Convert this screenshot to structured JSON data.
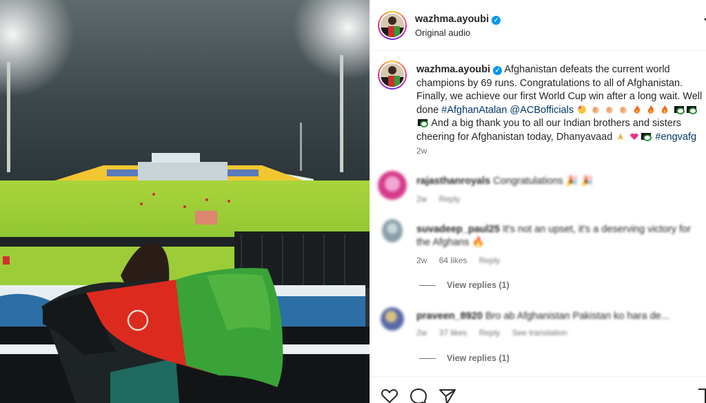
{
  "post": {
    "username": "wazhma.ayoubi",
    "audio": "Original audio",
    "more_icon": "more-dots-icon"
  },
  "caption": {
    "username": "wazhma.ayoubi",
    "text_1": "Afghanistan defeats the current world champions by 69 runs. Congratulations to all of Afghanistan. Finally, we achieve our first World Cup win after a long wait. Well done ",
    "hashtag_1": "#AfghanAtalan",
    "mention_1": "@ACBofficials",
    "text_2": "And a big thank you to all our Indian brothers and sisters cheering for Afghanistan today, Dhanyavaad ",
    "hashtag_2": "#engvafg",
    "time": "2w"
  },
  "comments": [
    {
      "username": "rajasthanroyals",
      "text": "Congratulations 🎉 🎉",
      "time": "2w",
      "reply": "Reply",
      "likes": "",
      "avatar_color": "#d63a8a"
    },
    {
      "username": "suvadeep_paul25",
      "text": "It's not an upset, it's a deserving victory for the Afghans 🔥",
      "time": "2w",
      "likes": "64 likes",
      "reply": "Reply",
      "view_replies": "View replies (1)",
      "avatar_color": "#8aa0a8"
    },
    {
      "username": "praveen_8920",
      "text": "Bro ab Afghanistan Pakistan ko hara de...",
      "time": "2w",
      "likes": "37 likes",
      "reply": "Reply",
      "translation": "See translation",
      "view_replies": "View replies (1)",
      "avatar_color": "#5a6aa8"
    }
  ],
  "actions": {
    "like_icon": "heart-icon",
    "comment_icon": "comment-icon",
    "share_icon": "share-icon",
    "save_icon": "bookmark-icon"
  },
  "colors": {
    "verified": "#0095f6",
    "link": "#00376b",
    "muted": "#737373"
  }
}
